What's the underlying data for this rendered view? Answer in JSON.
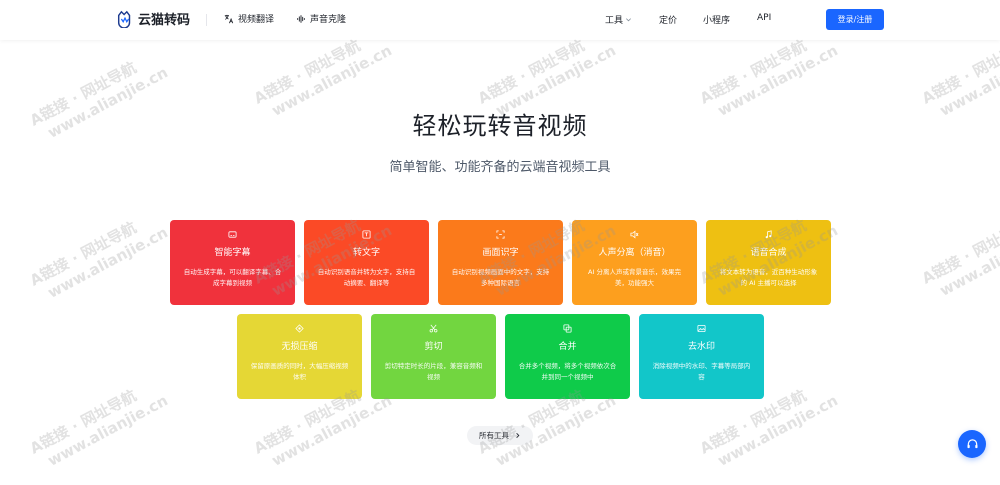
{
  "header": {
    "logo_text": "云猫转码",
    "nav_left": [
      {
        "label": "视频翻译",
        "icon": "translate-icon"
      },
      {
        "label": "声音克隆",
        "icon": "waveform-icon"
      }
    ],
    "nav_right": [
      {
        "label": "工具",
        "has_dropdown": true
      },
      {
        "label": "定价"
      },
      {
        "label": "小程序"
      },
      {
        "label": "API"
      }
    ],
    "login_label": "登录/注册"
  },
  "hero": {
    "title": "轻松玩转音视频",
    "subtitle": "简单智能、功能齐备的云端音视频工具"
  },
  "tools": [
    {
      "title": "智能字幕",
      "desc": "自动生成字幕，可以翻译字幕、合成字幕到视频",
      "icon": "subtitle-icon",
      "color": "#f0323c"
    },
    {
      "title": "转文字",
      "desc": "自动识别语音并转为文字，支持自动摘要、翻译等",
      "icon": "text-icon",
      "color": "#fb4a26"
    },
    {
      "title": "画面识字",
      "desc": "自动识别视频画面中的文字，支持多种国际语言",
      "icon": "scan-icon",
      "color": "#fb7a1b"
    },
    {
      "title": "人声分离（消音）",
      "desc": "AI 分离人声或背景音乐，效果完美，功能强大",
      "icon": "mute-icon",
      "color": "#fd9f1e"
    },
    {
      "title": "语音合成",
      "desc": "将文本转为语音，近百种生动形象的 AI 主播可以选择",
      "icon": "music-note-icon",
      "color": "#eec012"
    },
    {
      "title": "无损压缩",
      "desc": "保留原画质的同时，大幅压缩视频体积",
      "icon": "compress-icon",
      "color": "#e5d735"
    },
    {
      "title": "剪切",
      "desc": "剪切特定时长的片段，兼容音频和视频",
      "icon": "scissors-icon",
      "color": "#72d640"
    },
    {
      "title": "合并",
      "desc": "合并多个视频，将多个视频依次合并到同一个视频中",
      "icon": "merge-icon",
      "color": "#0fcb4a"
    },
    {
      "title": "去水印",
      "desc": "消除视频中的水印、字幕等局部内容",
      "icon": "watermark-icon",
      "color": "#12c6c9"
    }
  ],
  "all_tools_label": "所有工具",
  "watermark": {
    "line1": "A链接 · 网址导航",
    "line2": "www.alianjie.cn"
  }
}
